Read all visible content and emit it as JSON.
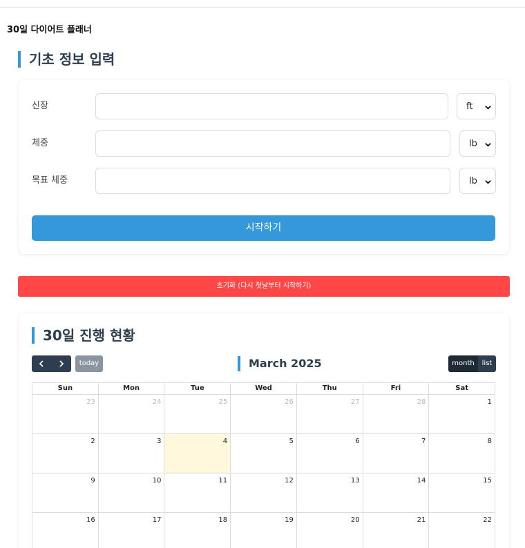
{
  "app_title": "30일 다이어트 플래너",
  "basic_info": {
    "title": "기초 정보 입력",
    "height": {
      "label": "신장",
      "value": "",
      "unit": "ft"
    },
    "weight": {
      "label": "체중",
      "value": "",
      "unit": "lb"
    },
    "target_weight": {
      "label": "목표 체중",
      "value": "",
      "unit": "lb"
    },
    "start_label": "시작하기"
  },
  "reset_label": "초기화 (다시 첫날부터 시작하기)",
  "progress": {
    "title": "30일 진행 현황",
    "toolbar": {
      "today_label": "today",
      "month_title": "March 2025",
      "view_month_label": "month",
      "view_list_label": "list"
    },
    "weekdays": [
      "Sun",
      "Mon",
      "Tue",
      "Wed",
      "Thu",
      "Fri",
      "Sat"
    ],
    "weeks": [
      [
        {
          "d": "23",
          "other": true
        },
        {
          "d": "24",
          "other": true
        },
        {
          "d": "25",
          "other": true
        },
        {
          "d": "26",
          "other": true
        },
        {
          "d": "27",
          "other": true
        },
        {
          "d": "28",
          "other": true
        },
        {
          "d": "1"
        }
      ],
      [
        {
          "d": "2"
        },
        {
          "d": "3"
        },
        {
          "d": "4",
          "today": true
        },
        {
          "d": "5"
        },
        {
          "d": "6"
        },
        {
          "d": "7"
        },
        {
          "d": "8"
        }
      ],
      [
        {
          "d": "9"
        },
        {
          "d": "10"
        },
        {
          "d": "11"
        },
        {
          "d": "12"
        },
        {
          "d": "13"
        },
        {
          "d": "14"
        },
        {
          "d": "15"
        }
      ],
      [
        {
          "d": "16"
        },
        {
          "d": "17"
        },
        {
          "d": "18"
        },
        {
          "d": "19"
        },
        {
          "d": "20"
        },
        {
          "d": "21"
        },
        {
          "d": "22"
        }
      ]
    ]
  },
  "colors": {
    "accent": "#3498db",
    "reset": "#ff4747",
    "today_highlight": "#fff8dc",
    "nav_dark": "#2c3e50"
  }
}
